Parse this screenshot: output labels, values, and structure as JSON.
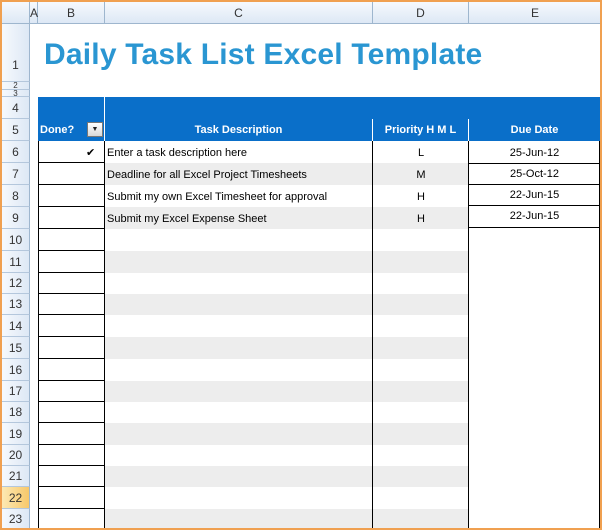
{
  "columns": [
    "A",
    "B",
    "C",
    "D",
    "E"
  ],
  "rows": [
    "1",
    "2",
    "3",
    "4",
    "5",
    "6",
    "7",
    "8",
    "9",
    "10",
    "11",
    "12",
    "13",
    "14",
    "15",
    "16",
    "17",
    "18",
    "19",
    "20",
    "21",
    "22",
    "23"
  ],
  "title": "Daily Task List Excel Template",
  "table": {
    "headers": {
      "done": "Done?",
      "task": "Task Description",
      "priority": "Priority H M L",
      "due": "Due Date"
    },
    "rows": [
      {
        "done": "✔",
        "task": "Enter a task description here",
        "priority": "L",
        "due": "25-Jun-12"
      },
      {
        "done": "",
        "task": "Deadline for all Excel Project Timesheets",
        "priority": "M",
        "due": "25-Oct-12"
      },
      {
        "done": "",
        "task": "Submit my own Excel Timesheet for approval",
        "priority": "H",
        "due": "22-Jun-15"
      },
      {
        "done": "",
        "task": "Submit my Excel Expense Sheet",
        "priority": "H",
        "due": "22-Jun-15"
      }
    ]
  },
  "icons": {
    "filter": "dropdown-arrow-icon",
    "check": "checkmark-icon"
  },
  "colors": {
    "accent": "#0a6fc9",
    "title": "#2a96d2",
    "selection": "#f7c86a",
    "frame": "#f0a050"
  },
  "selected_row": "22"
}
